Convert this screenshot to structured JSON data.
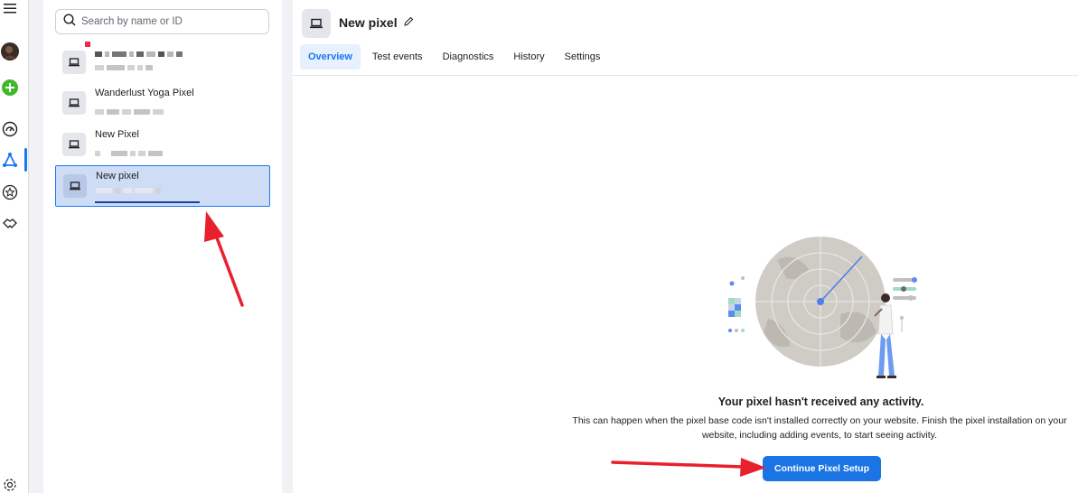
{
  "rail": {
    "icons": [
      "menu-icon",
      "avatar",
      "create-plus-icon",
      "dashboard-icon",
      "events-manager-icon",
      "star-icon",
      "partner-icon",
      "settings-icon"
    ]
  },
  "search": {
    "placeholder": "Search by name or ID"
  },
  "pixels": [
    {
      "name": "",
      "redacted": true
    },
    {
      "name": "Wanderlust Yoga Pixel"
    },
    {
      "name": "New Pixel"
    },
    {
      "name": "New pixel",
      "selected": true
    }
  ],
  "main": {
    "title": "New pixel",
    "tabs": [
      "Overview",
      "Test events",
      "Diagnostics",
      "History",
      "Settings"
    ],
    "active_tab": "Overview",
    "empty_title": "Your pixel hasn't received any activity.",
    "empty_desc": "This can happen when the pixel base code isn't installed correctly on your website. Finish the pixel installation on your website, including adding events, to start seeing activity.",
    "cta_label": "Continue Pixel Setup"
  },
  "colors": {
    "accent": "#1877f2",
    "cta": "#1b74e4",
    "selected_bg": "#cfdcf6",
    "annotation_arrow": "#e8202d"
  }
}
